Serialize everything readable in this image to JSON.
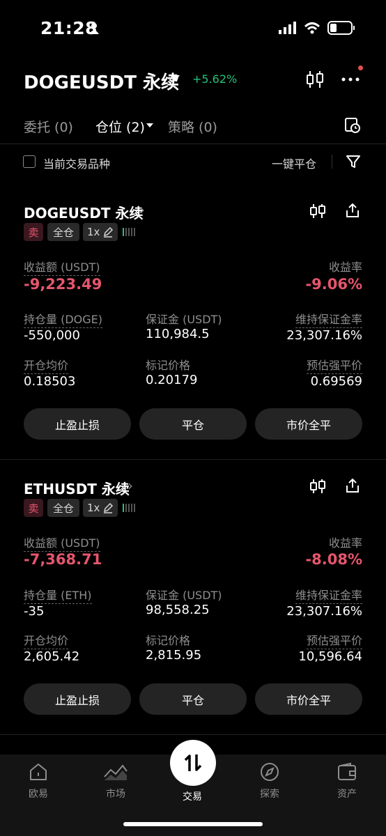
{
  "status_bar": {
    "time": "21:28"
  },
  "header": {
    "pair": "DOGEUSDT 永续",
    "change": "+5.62%"
  },
  "tabs": [
    {
      "label": "委托 (0)"
    },
    {
      "label": "仓位 (2)"
    },
    {
      "label": "策略 (0)"
    }
  ],
  "filter": {
    "current_only_label": "当前交易品种",
    "close_all_label": "一键平仓"
  },
  "positions": [
    {
      "title": "DOGEUSDT 永续",
      "side": "卖",
      "margin_mode": "全仓",
      "leverage": "1x",
      "pnl_label": "收益额 (USDT)",
      "pnl": "-9,223.49",
      "roe_label": "收益率",
      "roe": "-9.06%",
      "size_label": "持仓量 (DOGE)",
      "size": "-550,000",
      "margin_label": "保证金 (USDT)",
      "margin": "110,984.5",
      "mmr_label": "维持保证金率",
      "mmr": "23,307.16%",
      "entry_label": "开仓均价",
      "entry": "0.18503",
      "mark_label": "标记价格",
      "mark": "0.20179",
      "liq_label": "预估强平价",
      "liq": "0.69569",
      "btn_tpsl": "止盈止损",
      "btn_close": "平仓",
      "btn_market_close": "市价全平"
    },
    {
      "title": "ETHUSDT 永续",
      "side": "卖",
      "margin_mode": "全仓",
      "leverage": "1x",
      "pnl_label": "收益额 (USDT)",
      "pnl": "-7,368.71",
      "roe_label": "收益率",
      "roe": "-8.08%",
      "size_label": "持仓量 (ETH)",
      "size": "-35",
      "margin_label": "保证金 (USDT)",
      "margin": "98,558.25",
      "mmr_label": "维持保证金率",
      "mmr": "23,307.16%",
      "entry_label": "开仓均价",
      "entry": "2,605.42",
      "mark_label": "标记价格",
      "mark": "2,815.95",
      "liq_label": "预估强平价",
      "liq": "10,596.64",
      "btn_tpsl": "止盈止损",
      "btn_close": "平仓",
      "btn_market_close": "市价全平"
    }
  ],
  "nav": [
    {
      "label": "欧易",
      "icon": "home-icon"
    },
    {
      "label": "市场",
      "icon": "chart-icon"
    },
    {
      "label": "交易",
      "icon": "swap-icon"
    },
    {
      "label": "探索",
      "icon": "compass-icon"
    },
    {
      "label": "资产",
      "icon": "wallet-icon"
    }
  ],
  "colors": {
    "loss": "#e5566d",
    "gain": "#25c27a",
    "background": "#000000"
  }
}
